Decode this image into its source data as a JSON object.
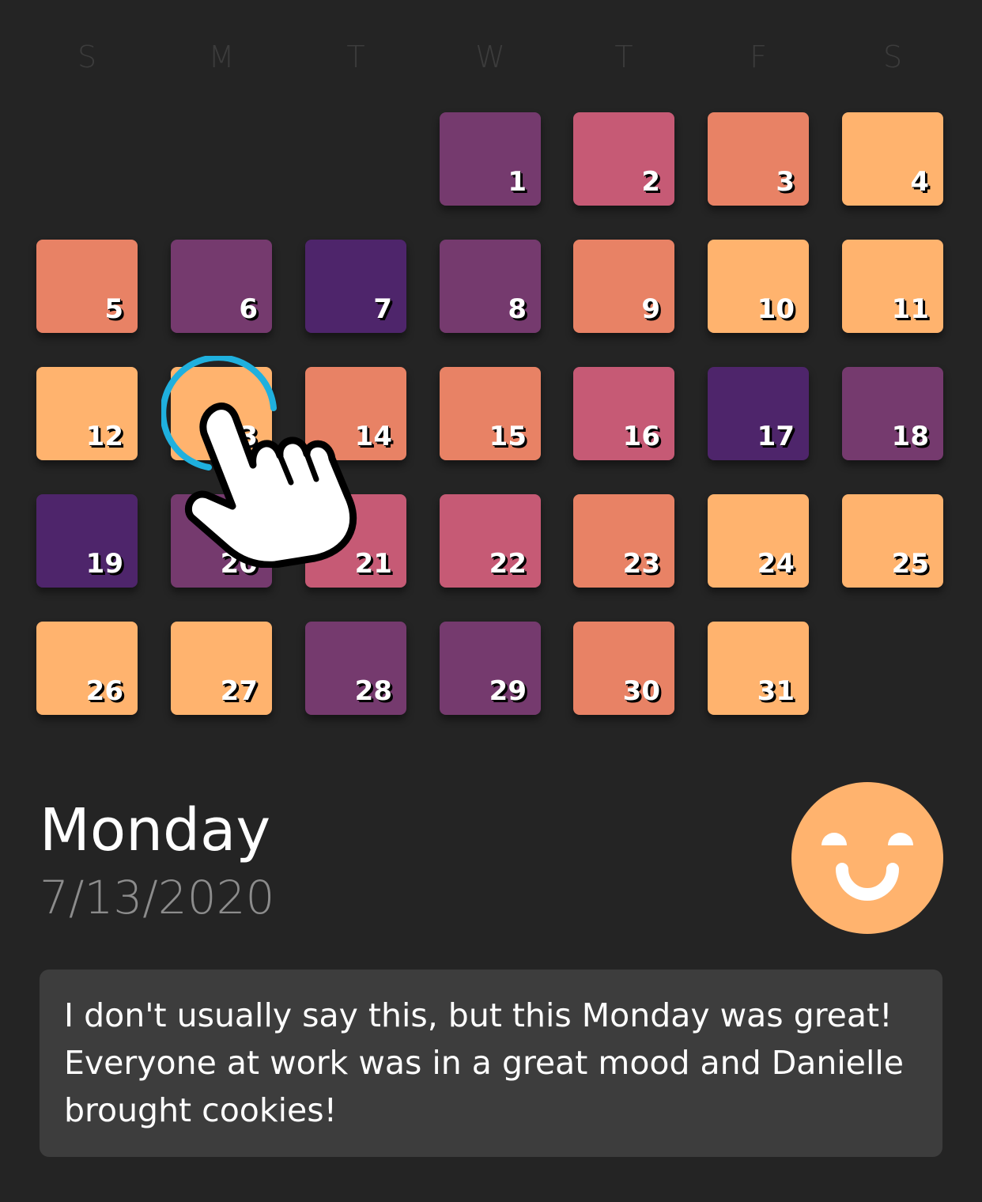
{
  "weekdays": [
    "S",
    "M",
    "T",
    "W",
    "T",
    "F",
    "S"
  ],
  "colors": {
    "background": "#242424",
    "weekday_text": "#3c3c3c",
    "mood_great": "#ffb36e",
    "mood_good": "#e88265",
    "mood_okay": "#c65a75",
    "mood_bad": "#753a6e",
    "mood_awful": "#4e256b",
    "tap_ring": "#1fb0de",
    "note_card": "#3d3d3d",
    "date_text": "#8c8c8c"
  },
  "calendar": {
    "first_weekday_index": 3,
    "days": [
      {
        "day": "1",
        "mood": "mood_bad"
      },
      {
        "day": "2",
        "mood": "mood_okay"
      },
      {
        "day": "3",
        "mood": "mood_good"
      },
      {
        "day": "4",
        "mood": "mood_great"
      },
      {
        "day": "5",
        "mood": "mood_good"
      },
      {
        "day": "6",
        "mood": "mood_bad"
      },
      {
        "day": "7",
        "mood": "mood_awful"
      },
      {
        "day": "8",
        "mood": "mood_bad"
      },
      {
        "day": "9",
        "mood": "mood_good"
      },
      {
        "day": "10",
        "mood": "mood_great"
      },
      {
        "day": "11",
        "mood": "mood_great"
      },
      {
        "day": "12",
        "mood": "mood_great"
      },
      {
        "day": "13",
        "mood": "mood_great",
        "selected": true
      },
      {
        "day": "14",
        "mood": "mood_good"
      },
      {
        "day": "15",
        "mood": "mood_good"
      },
      {
        "day": "16",
        "mood": "mood_okay"
      },
      {
        "day": "17",
        "mood": "mood_awful"
      },
      {
        "day": "18",
        "mood": "mood_bad"
      },
      {
        "day": "19",
        "mood": "mood_awful"
      },
      {
        "day": "20",
        "mood": "mood_bad"
      },
      {
        "day": "21",
        "mood": "mood_okay"
      },
      {
        "day": "22",
        "mood": "mood_okay"
      },
      {
        "day": "23",
        "mood": "mood_good"
      },
      {
        "day": "24",
        "mood": "mood_great"
      },
      {
        "day": "25",
        "mood": "mood_great"
      },
      {
        "day": "26",
        "mood": "mood_great"
      },
      {
        "day": "27",
        "mood": "mood_great"
      },
      {
        "day": "28",
        "mood": "mood_bad"
      },
      {
        "day": "29",
        "mood": "mood_bad"
      },
      {
        "day": "30",
        "mood": "mood_good"
      },
      {
        "day": "31",
        "mood": "mood_great"
      }
    ]
  },
  "detail": {
    "weekday": "Monday",
    "date": "7/13/2020",
    "mood_icon": "smiling-face-icon",
    "note": "I don't usually say this, but this Monday was great! Everyone at work was in a great mood and Danielle brought cookies!"
  },
  "icons": {
    "pointer": "pointing-hand-icon",
    "tap_indicator": "tap-ring-icon"
  }
}
